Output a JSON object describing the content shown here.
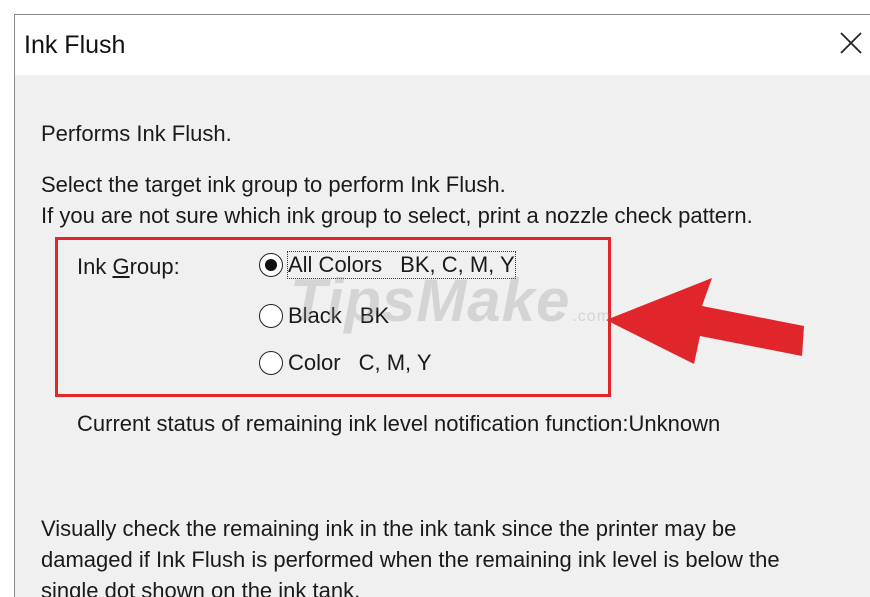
{
  "dialog": {
    "title": "Ink Flush",
    "intro": "Performs Ink Flush.",
    "instruction_line1": "Select the target ink group to perform Ink Flush.",
    "instruction_line2": "If you are not sure which ink group to select, print a nozzle check pattern.",
    "ink_group_label": "Ink Group:",
    "ink_group_label_accesskey": "G",
    "ink_group_options": [
      {
        "label": "All Colors",
        "detail": "BK, C, M, Y",
        "selected": true
      },
      {
        "label": "Black",
        "detail": "BK",
        "selected": false
      },
      {
        "label": "Color",
        "detail": "C, M, Y",
        "selected": false
      }
    ],
    "status_text": "Current status of remaining ink level notification function:Unknown",
    "warning_line1": "Visually check the remaining ink in the ink tank since the printer may be",
    "warning_line2": "damaged if Ink Flush is performed when the remaining ink level is below the",
    "warning_line3": "single dot shown on the ink tank."
  },
  "annotation": {
    "highlight_color": "#e0262a",
    "arrow_color": "#e0262a"
  },
  "watermark": {
    "text": "TipsMake",
    "suffix": ".com"
  },
  "icons": {
    "close": "close-icon"
  }
}
